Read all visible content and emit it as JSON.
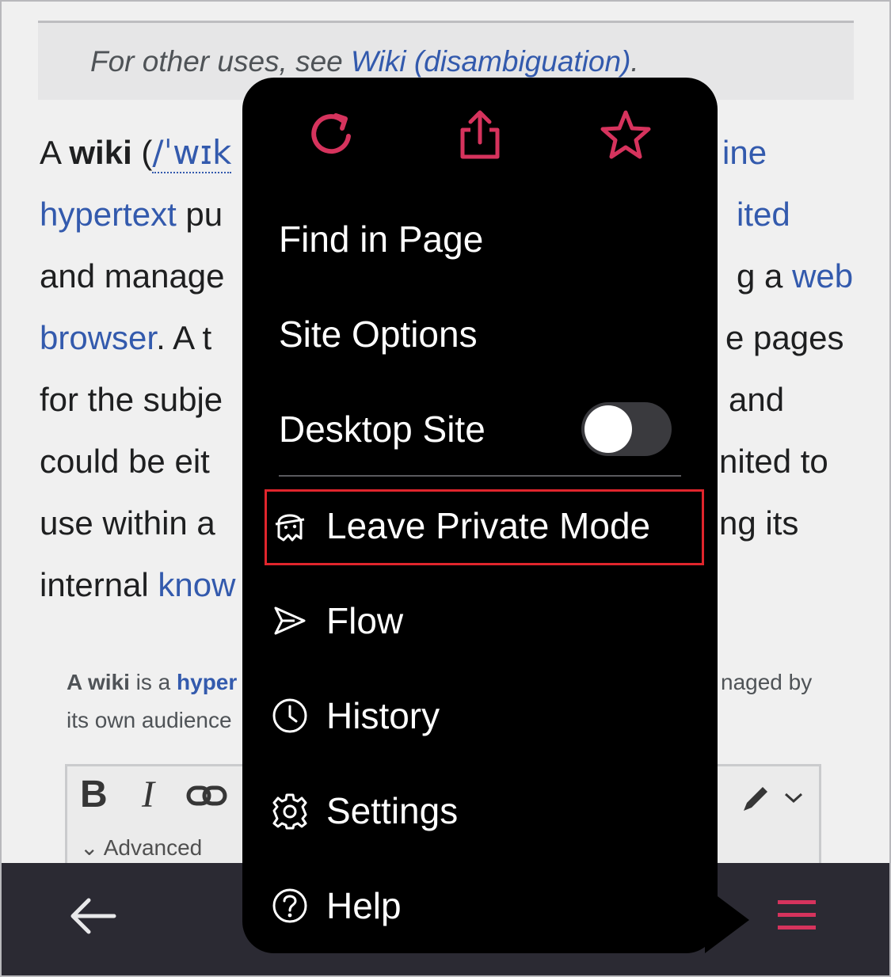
{
  "hatnote": {
    "prefix": "For other uses, see ",
    "link": "Wiki (disambiguation)",
    "suffix": "."
  },
  "article": {
    "l1_a": "A ",
    "l1_bold": "wiki",
    "l1_b": " (",
    "l1_ipa": "/ˈwɪk",
    "l1_right": "ine",
    "l2_link": "hypertext",
    "l2_b": " pu",
    "l2_right": "ited",
    "l3_a": "and manage",
    "l3_right_a": "g a ",
    "l3_right_link": "web",
    "l4_link": "browser",
    "l4_b": ". A t",
    "l4_right": "e pages",
    "l5_a": "for the subje",
    "l5_right": "and",
    "l6_a": "could be eit",
    "l6_right": "nited to",
    "l7_a": "use within a",
    "l7_right": "ng its",
    "l8_a": "internal ",
    "l8_link": "know"
  },
  "embed": {
    "cap1_bold": "A wiki",
    "cap1_a": " is a ",
    "cap1_link": "hyper",
    "cap1_right": "naged by",
    "cap2": "its own audience",
    "advanced": "⌄ Advanced"
  },
  "menu": {
    "top_icons": [
      "reload-icon",
      "share-icon",
      "bookmark-star-icon"
    ],
    "find_in_page": "Find in Page",
    "site_options": "Site Options",
    "desktop_site": "Desktop Site",
    "desktop_site_enabled": false,
    "leave_private_mode": "Leave Private Mode",
    "flow": "Flow",
    "history": "History",
    "settings": "Settings",
    "help": "Help"
  },
  "colors": {
    "accent": "#d6335d",
    "link": "#3760b8",
    "menu_bg": "#000000",
    "bar_bg": "#2b2a33",
    "highlight": "#e0252c"
  }
}
